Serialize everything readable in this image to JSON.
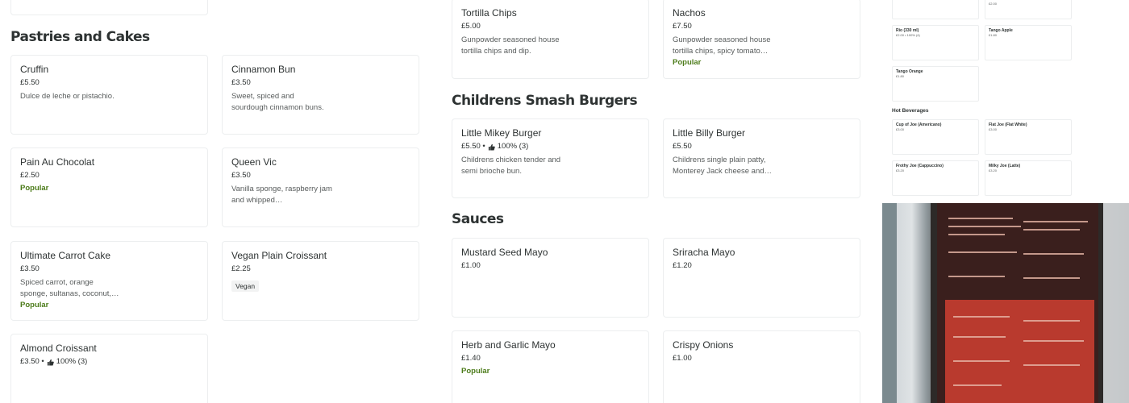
{
  "left_column": {
    "section_title": "Pastries and Cakes",
    "items": [
      {
        "name": "Cruffin",
        "price": "£5.50",
        "description": "Dulce de leche or pistachio.",
        "popular": ""
      },
      {
        "name": "Cinnamon Bun",
        "price": "£3.50",
        "description": "Sweet, spiced and sourdough cinnamon buns.",
        "popular": ""
      },
      {
        "name": "Pain Au Chocolat",
        "price": "£2.50",
        "description": "",
        "popular": "Popular"
      },
      {
        "name": "Queen Vic",
        "price": "£3.50",
        "description": "Vanilla sponge, raspberry jam and whipped…",
        "popular": ""
      },
      {
        "name": "Ultimate Carrot Cake",
        "price": "£3.50",
        "description": "Spiced carrot, orange sponge, sultanas, coconut,…",
        "popular": "Popular"
      },
      {
        "name": "Vegan Plain Croissant",
        "price": "£2.25",
        "description": "",
        "tag": "Vegan"
      },
      {
        "name": "Almond Croissant",
        "price": "£3.50 •",
        "rating": "100% (3)"
      }
    ]
  },
  "mid_column": {
    "top_items": [
      {
        "name": "Tortilla Chips",
        "price": "£5.00",
        "description": "Gunpowder seasoned house tortilla chips and dip."
      },
      {
        "name": "Nachos",
        "price": "£7.50",
        "description": "Gunpowder seasoned house tortilla chips, spicy tomato…",
        "popular": "Popular"
      }
    ],
    "burgers_title": "Childrens Smash Burgers",
    "burgers": [
      {
        "name": "Little Mikey Burger",
        "price": "£5.50 •",
        "rating": "100% (3)",
        "description": "Childrens chicken tender and semi brioche bun."
      },
      {
        "name": "Little Billy Burger",
        "price": "£5.50",
        "description": "Childrens single plain patty, Monterey Jack cheese and…"
      }
    ],
    "sauces_title": "Sauces",
    "sauces": [
      {
        "name": "Mustard Seed Mayo",
        "price": "£1.00"
      },
      {
        "name": "Sriracha Mayo",
        "price": "£1.20"
      },
      {
        "name": "Herb and Garlic Mayo",
        "price": "£1.40",
        "popular": "Popular"
      },
      {
        "name": "Crispy Onions",
        "price": "£1.00"
      }
    ]
  },
  "menu_thumbnail": {
    "cards": [
      {
        "name": "",
        "price": ""
      },
      {
        "name": "",
        "price": "£2.00"
      },
      {
        "name": "Rio (330 ml)",
        "price": "£2.00 • 100% (4)"
      },
      {
        "name": "Tango Apple",
        "price": "£1.80"
      },
      {
        "name": "Tango Orange",
        "price": "£1.80"
      }
    ],
    "hot_heading": "Hot Beverages",
    "hot_cards": [
      {
        "name": "Cup of Joe (Americano)",
        "price": "£3.00"
      },
      {
        "name": "Flat Joe (Flat White)",
        "price": "£3.00"
      },
      {
        "name": "Frothy Joe (Cappuccino)",
        "price": "£3.20"
      },
      {
        "name": "Milky Joe (Latte)",
        "price": "£3.20"
      }
    ]
  },
  "colors": {
    "popular": "#4d7c1b",
    "text": "#2e3333",
    "muted": "#585c5c",
    "border": "#eceeef"
  },
  "icons": {
    "rating": "thumbs-up-icon"
  }
}
